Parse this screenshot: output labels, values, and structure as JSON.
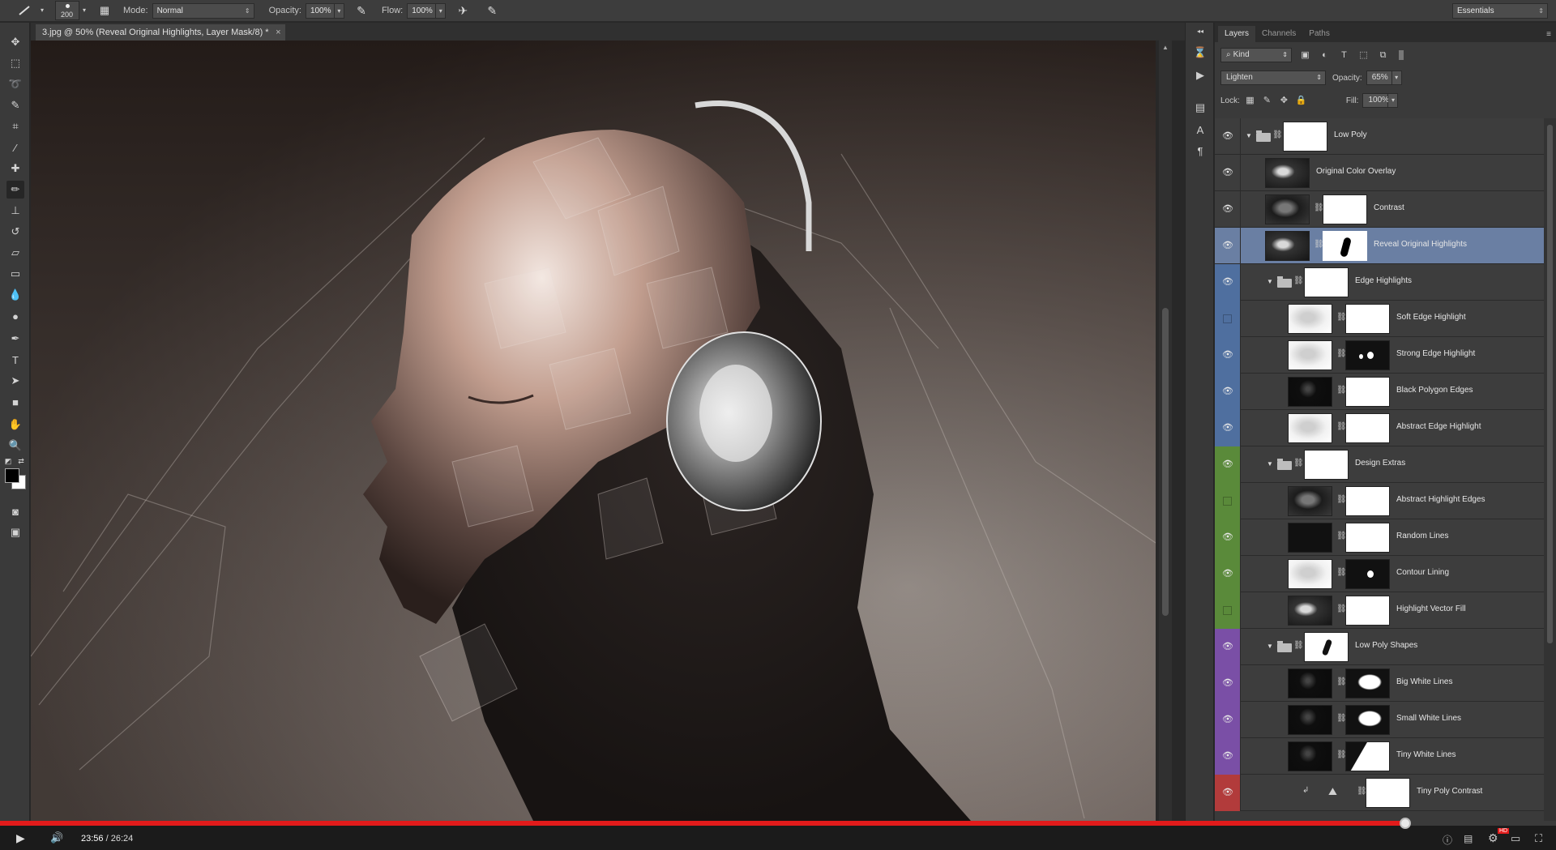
{
  "options_bar": {
    "brush_size": "200",
    "mode_label": "Mode:",
    "mode_value": "Normal",
    "opacity_label": "Opacity:",
    "opacity_value": "100%",
    "flow_label": "Flow:",
    "flow_value": "100%",
    "workspace": "Essentials"
  },
  "document": {
    "tab_title": "3.jpg @ 50% (Reveal Original Highlights, Layer Mask/8) *",
    "close_glyph": "×"
  },
  "layers_panel": {
    "tabs": [
      "Layers",
      "Channels",
      "Paths"
    ],
    "filter_kind": "Kind",
    "blend_mode": "Lighten",
    "opacity_label": "Opacity:",
    "opacity_value": "65%",
    "lock_label": "Lock:",
    "fill_label": "Fill:",
    "fill_value": "100%",
    "layers": [
      {
        "name": "Low Poly",
        "group": true,
        "indent": 0,
        "visible": true,
        "color": "none",
        "thumb": "white",
        "mask": null
      },
      {
        "name": "Original Color Overlay",
        "indent": 0,
        "visible": true,
        "color": "none",
        "thumb": "darkhead",
        "mask": null
      },
      {
        "name": "Contrast",
        "indent": 0,
        "visible": true,
        "color": "none",
        "thumb": "dark",
        "mask": "white"
      },
      {
        "name": "Reveal Original Highlights",
        "indent": 0,
        "visible": true,
        "color": "none",
        "thumb": "darkhead",
        "mask": "blob",
        "selected": true
      },
      {
        "name": "Edge Highlights",
        "group": true,
        "indent": 1,
        "visible": true,
        "color": "#4f6f9f",
        "thumb": "white",
        "mask": null
      },
      {
        "name": "Soft Edge Highlight",
        "indent": 2,
        "visible": false,
        "color": "#4f6f9f",
        "thumb": "whitesketch",
        "mask": "white"
      },
      {
        "name": "Strong Edge Highlight",
        "indent": 2,
        "visible": true,
        "color": "#4f6f9f",
        "thumb": "whitesketch",
        "mask": "blackblobs"
      },
      {
        "name": "Black Polygon Edges",
        "indent": 2,
        "visible": true,
        "color": "#4f6f9f",
        "thumb": "blackdots",
        "mask": "white"
      },
      {
        "name": "Abstract Edge Highlight",
        "indent": 2,
        "visible": true,
        "color": "#4f6f9f",
        "thumb": "whitesketch",
        "mask": "white"
      },
      {
        "name": "Design Extras",
        "group": true,
        "indent": 1,
        "visible": true,
        "color": "#5a8a3a",
        "thumb": "white",
        "mask": null
      },
      {
        "name": "Abstract Highlight Edges",
        "indent": 2,
        "visible": false,
        "color": "#5a8a3a",
        "thumb": "dark",
        "mask": "white"
      },
      {
        "name": "Random Lines",
        "indent": 2,
        "visible": true,
        "color": "#5a8a3a",
        "thumb": "black",
        "mask": "white"
      },
      {
        "name": "Contour Lining",
        "indent": 2,
        "visible": true,
        "color": "#5a8a3a",
        "thumb": "whitesketch",
        "mask": "blackdot"
      },
      {
        "name": "Highlight Vector Fill",
        "indent": 2,
        "visible": false,
        "color": "#5a8a3a",
        "thumb": "darkhead",
        "mask": "white"
      },
      {
        "name": "Low Poly Shapes",
        "group": true,
        "indent": 1,
        "visible": true,
        "color": "#7a4fa6",
        "thumb": "whiteblob",
        "mask": null
      },
      {
        "name": "Big White Lines",
        "indent": 2,
        "visible": true,
        "color": "#7a4fa6",
        "thumb": "blackdots",
        "mask": "headsil"
      },
      {
        "name": "Small White Lines",
        "indent": 2,
        "visible": true,
        "color": "#7a4fa6",
        "thumb": "blackdots",
        "mask": "headsil"
      },
      {
        "name": "Tiny White Lines",
        "indent": 2,
        "visible": true,
        "color": "#7a4fa6",
        "thumb": "blackdots",
        "mask": "half"
      },
      {
        "name": "Tiny Poly Contrast",
        "indent": 3,
        "visible": true,
        "color": "#b23b3b",
        "thumb": "adjust",
        "mask": "white"
      }
    ]
  },
  "video_player": {
    "current_time": "23:56",
    "separator": " / ",
    "duration": "26:24",
    "progress": 0.903,
    "hd_badge": "HD"
  },
  "colors": {
    "progress_red": "#e21b1b",
    "selected_layer": "#6a7fa3"
  }
}
